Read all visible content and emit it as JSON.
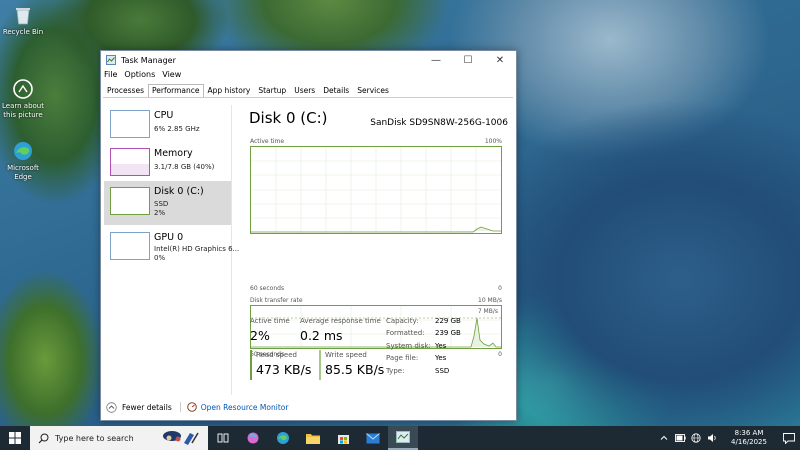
{
  "desktop": {
    "icons": [
      {
        "label": "Recycle Bin"
      },
      {
        "label": "Learn about this picture"
      },
      {
        "label": "Microsoft Edge"
      }
    ]
  },
  "window": {
    "title": "Task Manager",
    "controls": {
      "minimize": "—",
      "maximize": "☐",
      "close": "✕"
    },
    "menu": [
      "File",
      "Options",
      "View"
    ],
    "tabs": [
      "Processes",
      "Performance",
      "App history",
      "Startup",
      "Users",
      "Details",
      "Services"
    ],
    "active_tab": "Performance"
  },
  "devices": [
    {
      "name": "CPU",
      "line1": "6%  2.85 GHz",
      "line2": ""
    },
    {
      "name": "Memory",
      "line1": "3.1/7.8 GB (40%)",
      "line2": ""
    },
    {
      "name": "Disk 0 (C:)",
      "line1": "SSD",
      "line2": "2%"
    },
    {
      "name": "GPU 0",
      "line1": "Intel(R) HD Graphics 6...",
      "line2": "0%"
    }
  ],
  "detail": {
    "title": "Disk 0 (C:)",
    "model": "SanDisk SD9SN8W-256G-1006",
    "graph1": {
      "label": "Active time",
      "max": "100%",
      "time": "60 seconds",
      "min": "0"
    },
    "graph2": {
      "label": "Disk transfer rate",
      "max": "10 MB/s",
      "inner": "7 MB/s",
      "time": "60 seconds",
      "min": "0"
    },
    "stats": {
      "active_time_label": "Active time",
      "active_time": "2%",
      "avg_response_label": "Average response time",
      "avg_response": "0.2 ms",
      "read_label": "Read speed",
      "read": "473 KB/s",
      "write_label": "Write speed",
      "write": "85.5 KB/s"
    },
    "props": [
      {
        "k": "Capacity:",
        "v": "229 GB"
      },
      {
        "k": "Formatted:",
        "v": "239 GB"
      },
      {
        "k": "System disk:",
        "v": "Yes"
      },
      {
        "k": "Page file:",
        "v": "Yes"
      },
      {
        "k": "Type:",
        "v": "SSD"
      }
    ]
  },
  "footer": {
    "fewer_details": "Fewer details",
    "resource_monitor": "Open Resource Monitor"
  },
  "taskbar": {
    "search_placeholder": "Type here to search",
    "time": "8:36 AM",
    "date": "4/16/2025"
  },
  "colors": {
    "disk_accent": "#6f9f3e",
    "cpu_accent": "#7fa3c8",
    "memory_accent": "#b050b5",
    "taskbar": "#1d2a33"
  }
}
